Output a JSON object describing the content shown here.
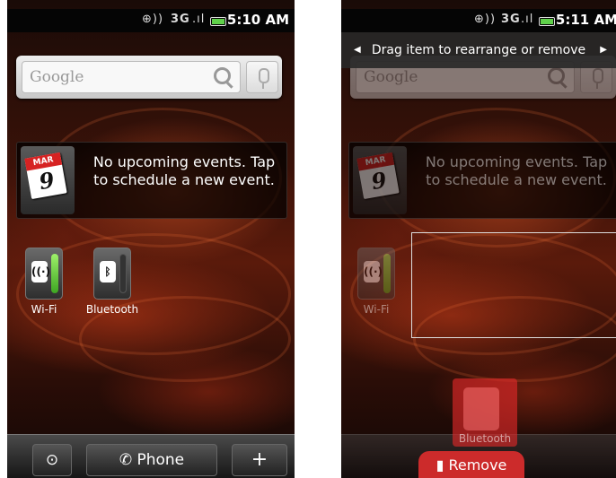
{
  "left_screen": {
    "status": {
      "signal": "3G",
      "time": "5:10 AM"
    },
    "search": {
      "placeholder": "Google"
    },
    "calendar": {
      "month": "MAR",
      "day": "9",
      "text": "No upcoming events. Tap to schedule a new event."
    },
    "toggles": [
      {
        "label": "Wi-Fi",
        "state": "on"
      },
      {
        "label": "Bluetooth",
        "state": "off"
      }
    ],
    "dock": {
      "left_icon": "up-arrow",
      "phone_label": "Phone",
      "plus_label": "+"
    }
  },
  "right_screen": {
    "status": {
      "signal": "3G",
      "time": "5:11 AM"
    },
    "banner": {
      "text": "Drag item to rearrange or remove"
    },
    "search": {
      "placeholder": "Google"
    },
    "calendar": {
      "month": "MAR",
      "day": "9",
      "text": "No upcoming events. Tap to schedule a new event."
    },
    "toggles": [
      {
        "label": "Wi-Fi",
        "state": "on"
      }
    ],
    "dragged_item": {
      "label": "Bluetooth"
    },
    "remove_label": "Remove"
  },
  "colors": {
    "remove_red": "#cc2b2b",
    "toggle_on_green": "#5fd14a",
    "calendar_red": "#d62222"
  }
}
